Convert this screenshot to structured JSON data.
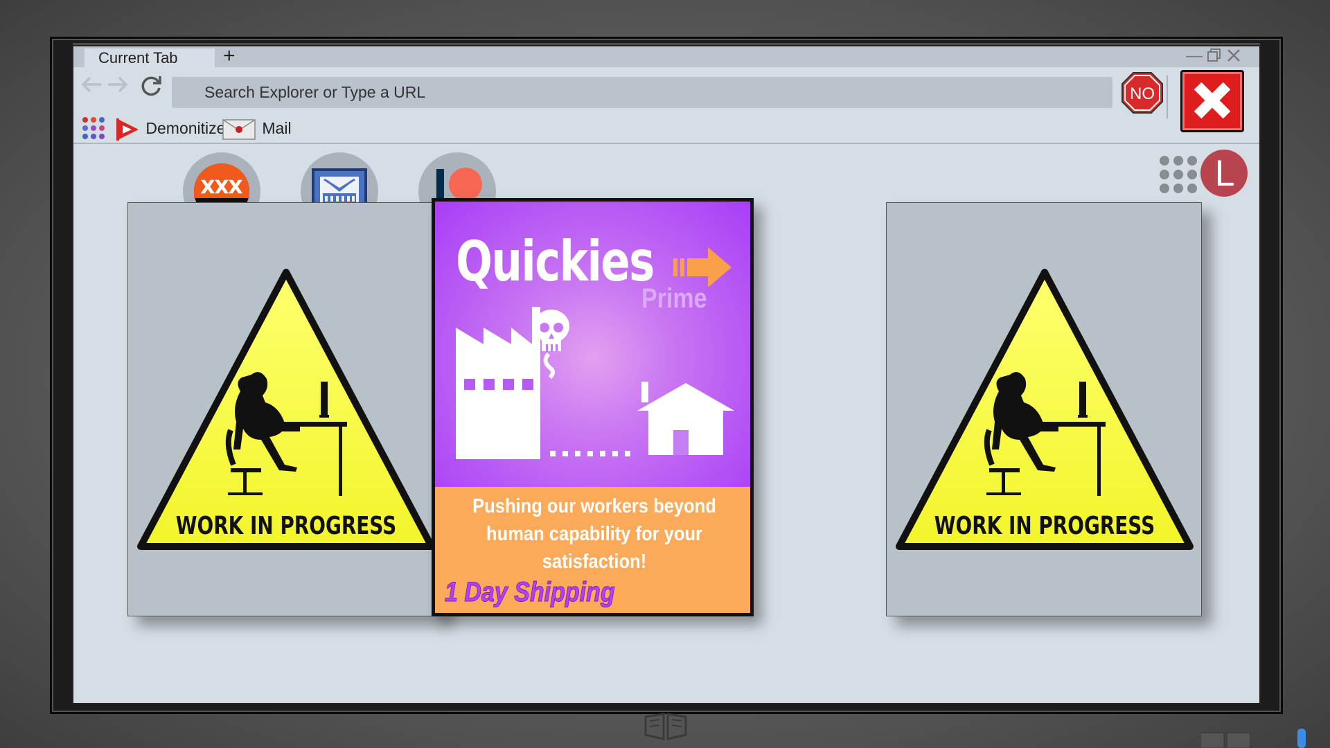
{
  "browser": {
    "tab": {
      "label": "Current Tab",
      "new_tab_symbol": "+"
    },
    "window_controls": [
      "minimize",
      "restore",
      "close"
    ],
    "nav": {
      "back_icon": "arrow-left-icon",
      "forward_icon": "arrow-right-icon",
      "reload_icon": "reload-icon"
    },
    "address_bar": {
      "placeholder": "Search Explorer or Type a URL"
    },
    "stop_sign_label": "NO",
    "bookmarks": [
      {
        "label": "Demonitizer",
        "icon": "play-flag-icon"
      },
      {
        "label": "Mail",
        "icon": "envelope-icon"
      }
    ]
  },
  "avatar": {
    "letter": "L",
    "color": "#b84450"
  },
  "shortcuts": [
    {
      "name": "xxx-shortcut",
      "label": "XXX"
    },
    {
      "name": "keyboard-shortcut"
    },
    {
      "name": "patreon-shortcut"
    }
  ],
  "cards": {
    "left": {
      "sign_text": "WORK IN PROGRESS"
    },
    "right": {
      "sign_text": "WORK IN PROGRESS"
    }
  },
  "ad": {
    "title": "Quickies",
    "subtitle": "Prime",
    "tagline_lines": [
      "Pushing our workers beyond",
      "human capability for your",
      "satisfaction!"
    ],
    "shipping": "1 Day Shipping"
  },
  "colors": {
    "screen_bg": "#d5dde5",
    "close_red": "#e01d1d",
    "ad_purple": "#a83df7",
    "ad_orange": "#fbaa5a",
    "warning_yellow": "#f6f93a"
  }
}
